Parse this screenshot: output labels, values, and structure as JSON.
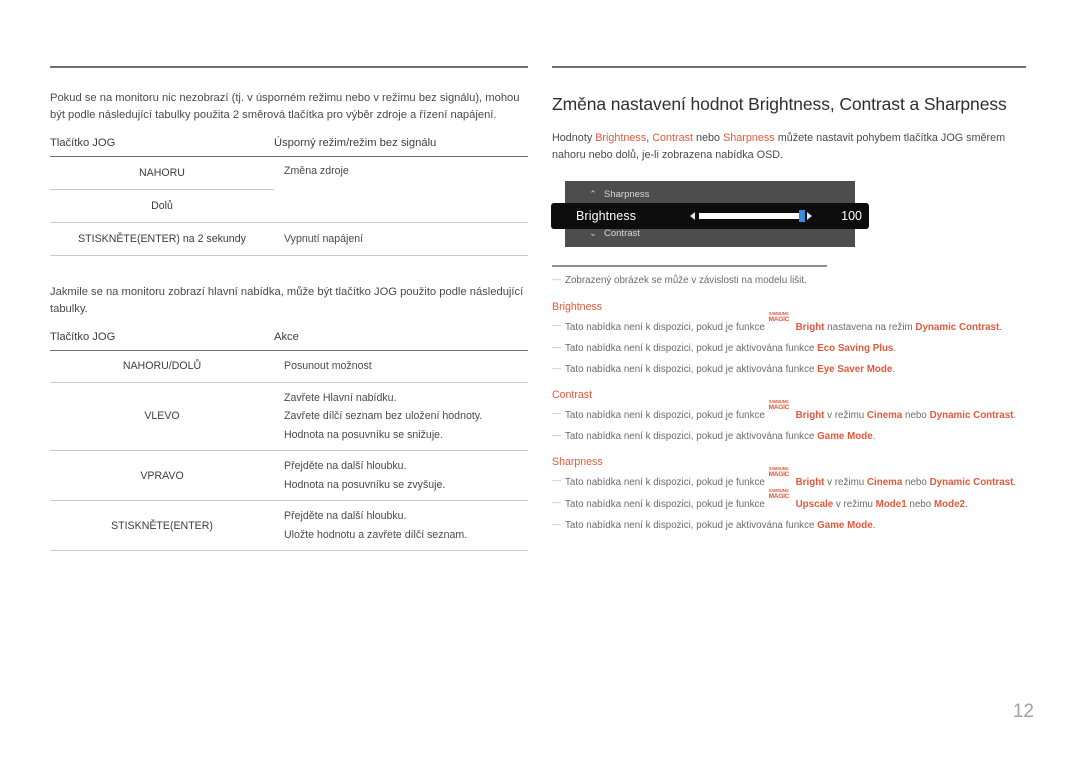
{
  "left": {
    "intro_paragraph": "Pokud se na monitoru nic nezobrazí (tj. v úsporném režimu nebo v režimu bez signálu), mohou být podle následující tabulky použita 2 směrová tlačítka pro výběr zdroje a řízení napájení.",
    "table1": {
      "headers": [
        "Tlačítko JOG",
        "Úsporný režim/režim bez signálu"
      ],
      "rows": [
        {
          "key": "NAHORU",
          "value": "Změna zdroje"
        },
        {
          "key": "Dolů",
          "value": ""
        },
        {
          "key": "STISKNĚTE(ENTER) na 2 sekundy",
          "value": "Vypnutí napájení"
        }
      ]
    },
    "second_paragraph": "Jakmile se na monitoru zobrazí hlavní nabídka, může být tlačítko JOG použito podle následující tabulky.",
    "table2": {
      "headers": [
        "Tlačítko JOG",
        "Akce"
      ],
      "rows": [
        {
          "key": "NAHORU/DOLŮ",
          "values": [
            "Posunout možnost"
          ]
        },
        {
          "key": "VLEVO",
          "values": [
            "Zavřete Hlavní nabídku.",
            "Zavřete dílčí seznam bez uložení hodnoty.",
            "Hodnota na posuvníku se snižuje."
          ]
        },
        {
          "key": "VPRAVO",
          "values": [
            "Přejděte na další hloubku.",
            "Hodnota na posuvníku se zvyšuje."
          ]
        },
        {
          "key": "STISKNĚTE(ENTER)",
          "values": [
            "Přejděte na další hloubku.",
            "Uložte hodnotu a zavřete dílčí seznam."
          ]
        }
      ]
    }
  },
  "right": {
    "heading": "Změna nastavení hodnot Brightness, Contrast a Sharpness",
    "intro": {
      "t1": "Hodnoty ",
      "l1": "Brightness",
      "t2": ", ",
      "l2": "Contrast",
      "t3": " nebo ",
      "l3": "Sharpness",
      "t4": " můžete nastavit pohybem tlačítka JOG směrem nahoru nebo dolů, je-li zobrazena nabídka OSD."
    },
    "osd": {
      "item_above": "Sharpness",
      "item_active": "Brightness",
      "item_below": "Contrast",
      "value": "100",
      "chevron_up": "⌃",
      "chevron_down": "⌄",
      "panel_color": "#4d4d4d",
      "active_color": "#0d0d0d",
      "knob_color": "#3a8ddd"
    },
    "notes": {
      "image_note": "Zobrazený obrázek se může v závislosti na modelu lišit.",
      "sections": [
        {
          "title": "Brightness",
          "items": [
            {
              "pre": "Tato nabídka není k dispozici, pokud je funkce ",
              "magic": true,
              "feature": "Bright",
              "mid": " nastavena na režim ",
              "tail_link": "Dynamic Contrast",
              "end": "."
            },
            {
              "pre": "Tato nabídka není k dispozici, pokud je aktivována funkce ",
              "magic": false,
              "tail_link": "Eco Saving Plus",
              "end": "."
            },
            {
              "pre": "Tato nabídka není k dispozici, pokud je aktivována funkce ",
              "magic": false,
              "tail_link": "Eye Saver Mode",
              "end": "."
            }
          ]
        },
        {
          "title": "Contrast",
          "items": [
            {
              "pre": "Tato nabídka není k dispozici, pokud je funkce ",
              "magic": true,
              "feature": "Bright",
              "mid": " v režimu ",
              "link_a": "Cinema",
              "mid2": " nebo ",
              "tail_link": "Dynamic Contrast",
              "end": "."
            },
            {
              "pre": "Tato nabídka není k dispozici, pokud je aktivována funkce ",
              "magic": false,
              "tail_link": "Game Mode",
              "end": "."
            }
          ]
        },
        {
          "title": "Sharpness",
          "items": [
            {
              "pre": "Tato nabídka není k dispozici, pokud je funkce ",
              "magic": true,
              "feature": "Bright",
              "mid": " v režimu ",
              "link_a": "Cinema",
              "mid2": " nebo ",
              "tail_link": "Dynamic Contrast",
              "end": "."
            },
            {
              "pre": "Tato nabídka není k dispozici, pokud je funkce ",
              "magic": true,
              "feature": "Upscale",
              "mid": " v režimu ",
              "link_a": "Mode1",
              "mid2": " nebo ",
              "tail_link": "Mode2",
              "end": "."
            },
            {
              "pre": "Tato nabídka není k dispozici, pokud je aktivována funkce ",
              "magic": false,
              "tail_link": "Game Mode",
              "end": "."
            }
          ]
        }
      ],
      "magic_logo": {
        "top": "SAMSUNG",
        "bottom": "MAGIC"
      }
    }
  },
  "footer": {
    "page_number": "12"
  },
  "colors": {
    "accent": "#e2593b",
    "heading": "#2d2d33",
    "body": "#4a4a4a",
    "rule": "#6e6e73"
  }
}
